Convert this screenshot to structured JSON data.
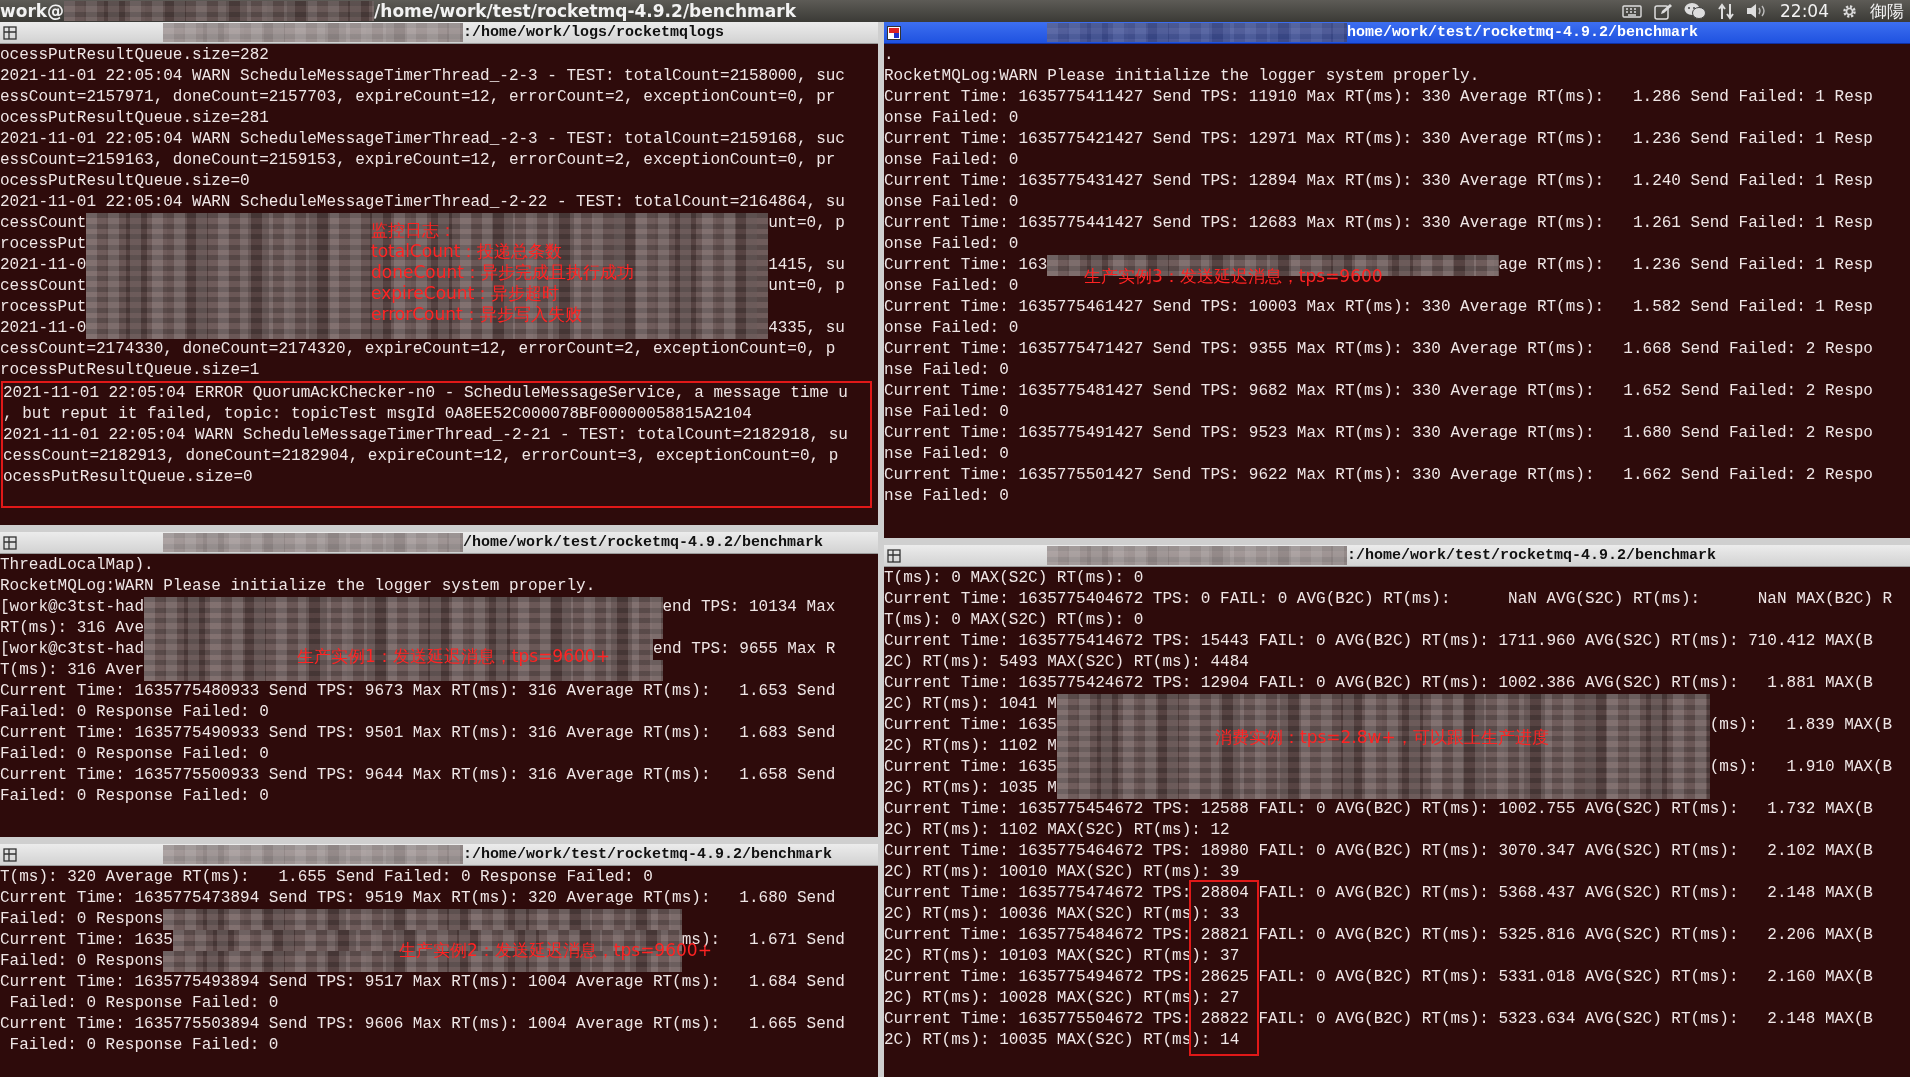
{
  "topbar": {
    "title_prefix": "work@",
    "title_path": "/home/work/test/rocketmq-4.9.2/benchmark",
    "clock": "22:04",
    "user": "御陽"
  },
  "left_column": {
    "panes": [
      {
        "title": {
          "path": ":/home/work/logs/rocketmqlogs",
          "active": false
        },
        "annotation": [
          "监控日志：",
          "totalCount：投递总条数",
          "doneCount：异步完成且执行成功",
          "expireCount：异步超时",
          "errorCount：异步写入失败"
        ],
        "groups": [
          {
            "kind": "plain",
            "lines": [
              {
                "kind": "plain",
                "text": "ocessPutResultQueue.size=282"
              },
              {
                "kind": "plain",
                "text": "2021-11-01 22:05:04 WARN ScheduleMessageTimerThread_-2-3 - TEST: totalCount=2158000, suc"
              },
              {
                "kind": "plain",
                "text": "essCount=2157971, doneCount=2157703, expireCount=12, errorCount=2, exceptionCount=0, pr"
              },
              {
                "kind": "plain",
                "text": "ocessPutResultQueue.size=281"
              },
              {
                "kind": "plain",
                "text": "2021-11-01 22:05:04 WARN ScheduleMessageTimerThread_-2-3 - TEST: totalCount=2159168, suc"
              },
              {
                "kind": "plain",
                "text": "essCount=2159163, doneCount=2159153, expireCount=12, errorCount=2, exceptionCount=0, pr"
              },
              {
                "kind": "plain",
                "text": "ocessPutResultQueue.size=0"
              },
              {
                "kind": "plain",
                "text": "2021-11-01 22:05:04 WARN ScheduleMessageTimerThread_-2-22 - TEST: totalCount=2164864, su"
              },
              {
                "kind": "redacted",
                "text": "cessCount",
                "tail": "unt=0, p"
              },
              {
                "kind": "redacted",
                "text": "rocessPut"
              },
              {
                "kind": "redacted",
                "text": "2021-11-0",
                "tail": "1415, su"
              },
              {
                "kind": "redacted",
                "text": "cessCount",
                "tail": "unt=0, p"
              },
              {
                "kind": "redacted",
                "text": "rocessPut"
              },
              {
                "kind": "redacted",
                "text": "2021-11-0",
                "tail": "4335, su"
              },
              {
                "kind": "plain",
                "text": "cessCount=2174330, doneCount=2174320, expireCount=12, errorCount=2, exceptionCount=0, p"
              },
              {
                "kind": "plain",
                "text": "rocessPutResultQueue.size=1"
              }
            ]
          },
          {
            "kind": "row_box",
            "lines": [
              {
                "kind": "plain",
                "text": "2021-11-01 22:05:04 ERROR QuorumAckChecker-n0 - ScheduleMessageService, a message time u"
              },
              {
                "kind": "plain",
                "text": ", but reput it failed, topic: topicTest msgId 0A8EE52C000078BF00000058815A2104"
              },
              {
                "kind": "plain",
                "text": "2021-11-01 22:05:04 WARN ScheduleMessageTimerThread_-2-21 - TEST: totalCount=2182918, su"
              },
              {
                "kind": "plain",
                "text": "cessCount=2182913, doneCount=2182904, expireCount=12, errorCount=3, exceptionCount=0, p"
              },
              {
                "kind": "plain",
                "text": "ocessPutResultQueue.size=0"
              }
            ]
          }
        ]
      },
      {
        "title": {
          "path": "/home/work/test/rocketmq-4.9.2/benchmark",
          "active": false
        },
        "annotation": [
          "生产实例1：发送延迟消息，tps=9600+"
        ],
        "groups": [
          {
            "kind": "plain",
            "lines": [
              {
                "kind": "plain",
                "text": "ThreadLocalMap)."
              },
              {
                "kind": "plain",
                "text": "RocketMQLog:WARN Please initialize the logger system properly."
              },
              {
                "kind": "redacted",
                "text": "[work@c3tst-had",
                "tail": "end TPS: 10134 Max"
              },
              {
                "kind": "redacted",
                "text": "RT(ms): 316 Ave"
              },
              {
                "kind": "redacted",
                "text": "[work@c3tst-had",
                "tail": "end TPS: 9655 Max R"
              },
              {
                "kind": "redacted",
                "text": "T(ms): 316 Aver"
              },
              {
                "kind": "plain",
                "text": "Current Time: 1635775480933 Send TPS: 9673 Max RT(ms): 316 Average RT(ms):   1.653 Send"
              },
              {
                "kind": "plain",
                "text": "Failed: 0 Response Failed: 0"
              },
              {
                "kind": "plain",
                "text": "Current Time: 1635775490933 Send TPS: 9501 Max RT(ms): 316 Average RT(ms):   1.683 Send"
              },
              {
                "kind": "plain",
                "text": "Failed: 0 Response Failed: 0"
              },
              {
                "kind": "plain",
                "text": "Current Time: 1635775500933 Send TPS: 9644 Max RT(ms): 316 Average RT(ms):   1.658 Send"
              },
              {
                "kind": "plain",
                "text": "Failed: 0 Response Failed: 0"
              }
            ]
          }
        ]
      },
      {
        "title": {
          "path": ":/home/work/test/rocketmq-4.9.2/benchmark",
          "active": false
        },
        "annotation": [
          "生产实例2：发送延迟消息，tps=9600+"
        ],
        "groups": [
          {
            "kind": "plain",
            "lines": [
              {
                "kind": "plain",
                "text": "T(ms): 320 Average RT(ms):   1.655 Send Failed: 0 Response Failed: 0"
              },
              {
                "kind": "plain",
                "text": "Current Time: 1635775473894 Send TPS: 9519 Max RT(ms): 320 Average RT(ms):   1.680 Send"
              },
              {
                "kind": "redacted",
                "text": "Failed: 0 Respons"
              },
              {
                "kind": "redacted",
                "text": "Current Time: 1635",
                "tail": "ms):   1.671 Send"
              },
              {
                "kind": "redacted",
                "text": "Failed: 0 Respons"
              },
              {
                "kind": "plain",
                "text": "Current Time: 1635775493894 Send TPS: 9517 Max RT(ms): 1004 Average RT(ms):   1.684 Send"
              },
              {
                "kind": "plain",
                "text": " Failed: 0 Response Failed: 0"
              },
              {
                "kind": "plain",
                "text": "Current Time: 1635775503894 Send TPS: 9606 Max RT(ms): 1004 Average RT(ms):   1.665 Send"
              },
              {
                "kind": "plain",
                "text": " Failed: 0 Response Failed: 0"
              }
            ]
          }
        ]
      }
    ]
  },
  "right_column": {
    "panes": [
      {
        "title": {
          "path": "home/work/test/rocketmq-4.9.2/benchmark",
          "active": true
        },
        "annotation": [
          "生产实例3：发送延迟消息，tps=9600"
        ],
        "groups": [
          {
            "kind": "plain",
            "lines": [
              {
                "kind": "plain",
                "text": "."
              },
              {
                "kind": "plain",
                "text": "RocketMQLog:WARN Please initialize the logger system properly."
              },
              {
                "kind": "plain",
                "text": "Current Time: 1635775411427 Send TPS: 11910 Max RT(ms): 330 Average RT(ms):   1.286 Send Failed: 1 Resp"
              },
              {
                "kind": "plain",
                "text": "onse Failed: 0"
              },
              {
                "kind": "plain",
                "text": "Current Time: 1635775421427 Send TPS: 12971 Max RT(ms): 330 Average RT(ms):   1.236 Send Failed: 1 Resp"
              },
              {
                "kind": "plain",
                "text": "onse Failed: 0"
              },
              {
                "kind": "plain",
                "text": "Current Time: 1635775431427 Send TPS: 12894 Max RT(ms): 330 Average RT(ms):   1.240 Send Failed: 1 Resp"
              },
              {
                "kind": "plain",
                "text": "onse Failed: 0"
              },
              {
                "kind": "plain",
                "text": "Current Time: 1635775441427 Send TPS: 12683 Max RT(ms): 330 Average RT(ms):   1.261 Send Failed: 1 Resp"
              },
              {
                "kind": "plain",
                "text": "onse Failed: 0"
              },
              {
                "kind": "redacted",
                "text": "Current Time: 163",
                "tail": "age RT(ms):   1.236 Send Failed: 1 Resp"
              },
              {
                "kind": "plain",
                "text": "onse Failed: 0"
              },
              {
                "kind": "plain",
                "text": "Current Time: 1635775461427 Send TPS: 10003 Max RT(ms): 330 Average RT(ms):   1.582 Send Failed: 1 Resp"
              },
              {
                "kind": "plain",
                "text": "onse Failed: 0"
              },
              {
                "kind": "plain",
                "text": "Current Time: 1635775471427 Send TPS: 9355 Max RT(ms): 330 Average RT(ms):   1.668 Send Failed: 2 Respo"
              },
              {
                "kind": "plain",
                "text": "nse Failed: 0"
              },
              {
                "kind": "plain",
                "text": "Current Time: 1635775481427 Send TPS: 9682 Max RT(ms): 330 Average RT(ms):   1.652 Send Failed: 2 Respo"
              },
              {
                "kind": "plain",
                "text": "nse Failed: 0"
              },
              {
                "kind": "plain",
                "text": "Current Time: 1635775491427 Send TPS: 9523 Max RT(ms): 330 Average RT(ms):   1.680 Send Failed: 2 Respo"
              },
              {
                "kind": "plain",
                "text": "nse Failed: 0"
              },
              {
                "kind": "plain",
                "text": "Current Time: 1635775501427 Send TPS: 9622 Max RT(ms): 330 Average RT(ms):   1.662 Send Failed: 2 Respo"
              },
              {
                "kind": "plain",
                "text": "nse Failed: 0"
              }
            ]
          }
        ]
      },
      {
        "title": {
          "path": ":/home/work/test/rocketmq-4.9.2/benchmark",
          "active": false
        },
        "annotation": [
          "消费实例：tps=2.8w+，可以跟上生产进度"
        ],
        "groups": [
          {
            "kind": "plain",
            "lines": [
              {
                "kind": "plain",
                "text": "T(ms): 0 MAX(S2C) RT(ms): 0"
              },
              {
                "kind": "plain",
                "text": "Current Time: 1635775404672 TPS: 0 FAIL: 0 AVG(B2C) RT(ms):      NaN AVG(S2C) RT(ms):      NaN MAX(B2C) R"
              },
              {
                "kind": "plain",
                "text": "T(ms): 0 MAX(S2C) RT(ms): 0"
              },
              {
                "kind": "plain",
                "text": "Current Time: 1635775414672 TPS: 15443 FAIL: 0 AVG(B2C) RT(ms): 1711.960 AVG(S2C) RT(ms): 710.412 MAX(B"
              },
              {
                "kind": "plain",
                "text": "2C) RT(ms): 5493 MAX(S2C) RT(ms): 4484"
              },
              {
                "kind": "plain",
                "text": "Current Time: 1635775424672 TPS: 12904 FAIL: 0 AVG(B2C) RT(ms): 1002.386 AVG(S2C) RT(ms):   1.881 MAX(B"
              },
              {
                "kind": "redacted",
                "text": "2C) RT(ms): 1041 M"
              },
              {
                "kind": "redacted",
                "text": "Current Time: 1635",
                "tail": "(ms):   1.839 MAX(B"
              },
              {
                "kind": "redacted",
                "text": "2C) RT(ms): 1102 M"
              },
              {
                "kind": "redacted",
                "text": "Current Time: 1635",
                "tail": "(ms):   1.910 MAX(B"
              },
              {
                "kind": "redacted",
                "text": "2C) RT(ms): 1035 M"
              },
              {
                "kind": "plain",
                "text": "Current Time: 1635775454672 TPS: 12588 FAIL: 0 AVG(B2C) RT(ms): 1002.755 AVG(S2C) RT(ms):   1.732 MAX(B"
              },
              {
                "kind": "plain",
                "text": "2C) RT(ms): 1102 MAX(S2C) RT(ms): 12"
              },
              {
                "kind": "plain",
                "text": "Current Time: 1635775464672 TPS: 18980 FAIL: 0 AVG(B2C) RT(ms): 3070.347 AVG(S2C) RT(ms):   2.102 MAX(B"
              },
              {
                "kind": "plain",
                "text": "2C) RT(ms): 10010 MAX(S2C) RT(ms): 39"
              }
            ]
          },
          {
            "kind": "column_box",
            "lines": [
              {
                "kind": "plain",
                "text": "Current Time: 1635775474672 TPS: 28804 FAIL: 0 AVG(B2C) RT(ms): 5368.437 AVG(S2C) RT(ms):   2.148 MAX(B"
              },
              {
                "kind": "plain",
                "text": "2C) RT(ms): 10036 MAX(S2C) RT(ms): 33"
              },
              {
                "kind": "plain",
                "text": "Current Time: 1635775484672 TPS: 28821 FAIL: 0 AVG(B2C) RT(ms): 5325.816 AVG(S2C) RT(ms):   2.206 MAX(B"
              },
              {
                "kind": "plain",
                "text": "2C) RT(ms): 10103 MAX(S2C) RT(ms): 37"
              },
              {
                "kind": "plain",
                "text": "Current Time: 1635775494672 TPS: 28625 FAIL: 0 AVG(B2C) RT(ms): 5331.018 AVG(S2C) RT(ms):   2.160 MAX(B"
              },
              {
                "kind": "plain",
                "text": "2C) RT(ms): 10028 MAX(S2C) RT(ms): 27"
              },
              {
                "kind": "plain",
                "text": "Current Time: 1635775504672 TPS: 28822 FAIL: 0 AVG(B2C) RT(ms): 5323.634 AVG(S2C) RT(ms):   2.148 MAX(B"
              },
              {
                "kind": "plain",
                "text": "2C) RT(ms): 10035 MAX(S2C) RT(ms): 14"
              }
            ]
          }
        ]
      }
    ]
  }
}
